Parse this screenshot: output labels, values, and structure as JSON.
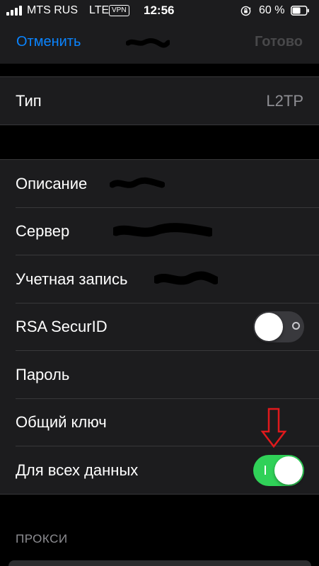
{
  "status_bar": {
    "carrier": "MTS RUS",
    "network": "LTE",
    "vpn_badge": "VPN",
    "time": "12:56",
    "battery_percent": "60 %",
    "battery_level": 0.6,
    "icons": [
      "signal-icon",
      "orientation-lock-icon",
      "battery-icon"
    ]
  },
  "nav": {
    "cancel_label": "Отменить",
    "done_label": "Готово",
    "colors": {
      "cancel": "#0a84ff",
      "done_disabled": "#48484a"
    }
  },
  "type_row": {
    "label": "Тип",
    "value": "L2TP"
  },
  "fields": {
    "description_label": "Описание",
    "server_label": "Сервер",
    "account_label": "Учетная запись",
    "rsa_label": "RSA SecurID",
    "rsa_enabled": false,
    "password_label": "Пароль",
    "shared_key_label": "Общий ключ",
    "all_traffic_label": "Для всех данных",
    "all_traffic_enabled": true
  },
  "proxy": {
    "section_header": "ПРОКСИ"
  },
  "colors": {
    "background": "#000000",
    "cell": "#1c1c1e",
    "separator": "#38383a",
    "toggle_on": "#30d158",
    "toggle_off": "#39393d",
    "annotation": "#e0191c"
  }
}
